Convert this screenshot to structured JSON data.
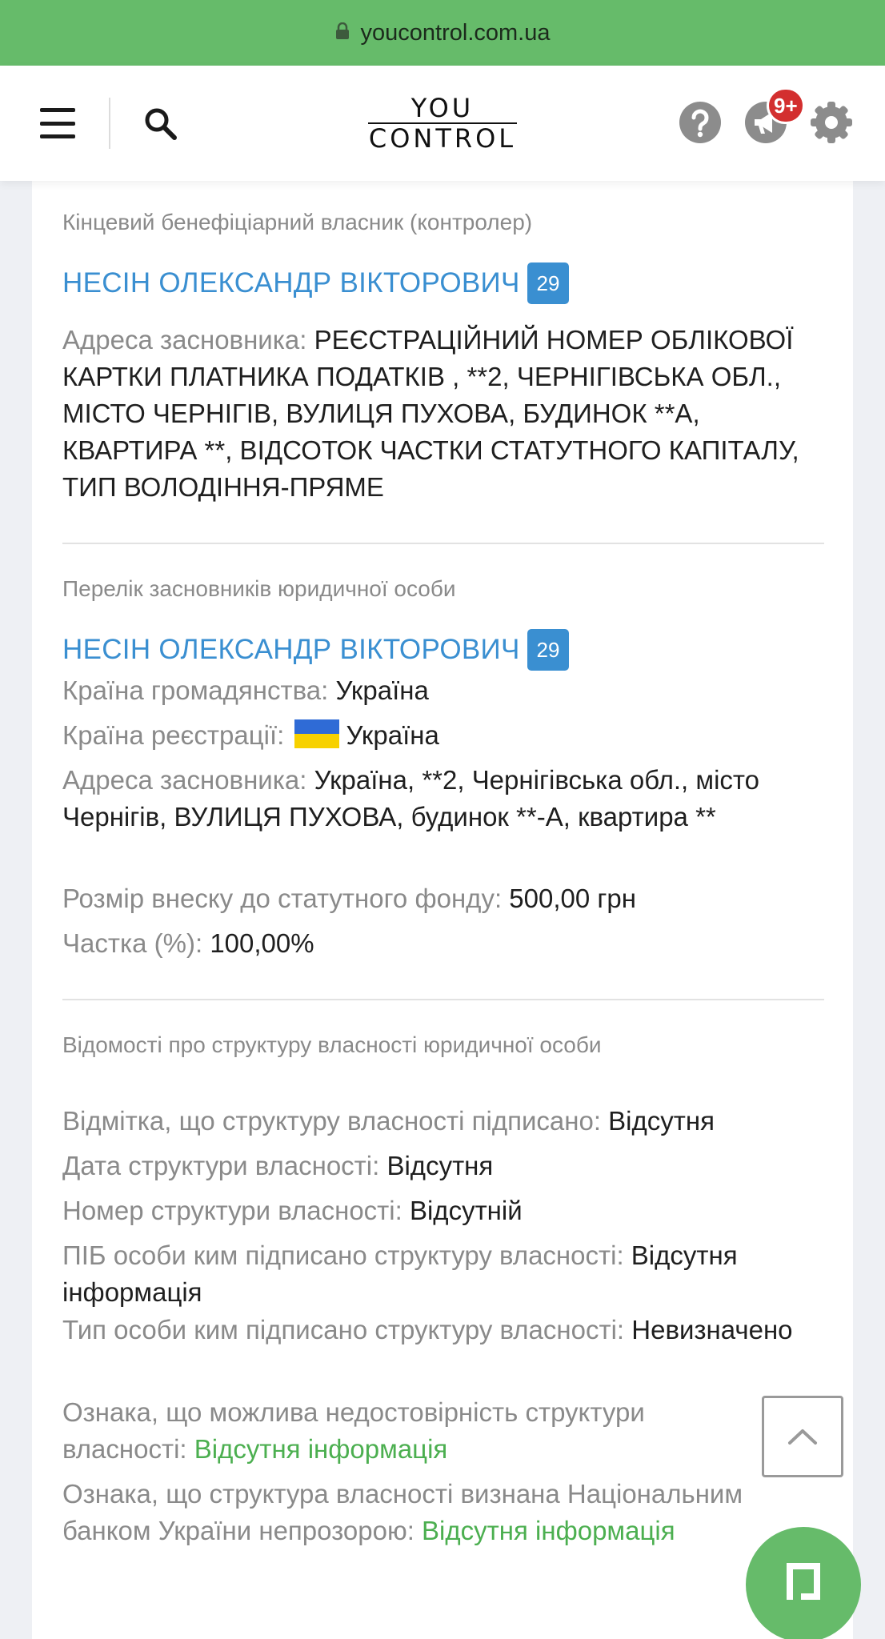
{
  "browser": {
    "url": "youcontrol.com.ua"
  },
  "header": {
    "logo_top": "YOU",
    "logo_bottom": "CONTROL",
    "notifications_badge": "9+",
    "icons": [
      "menu-icon",
      "search-icon",
      "help-icon",
      "megaphone-icon",
      "gear-icon"
    ]
  },
  "beneficiary": {
    "section_title": "Кінцевий бенефіціарний власник (контролер)",
    "name": "НЕСІН ОЛЕКСАНДР ВІКТОРОВИЧ",
    "badge": "29",
    "address_label": "Адреса засновника: ",
    "address_value": "РЕЄСТРАЦІЙНИЙ НОМЕР ОБЛІКОВОЇ КАРТКИ ПЛАТНИКА ПОДАТКІВ , **2, ЧЕРНІГІВСЬКА ОБЛ., МІСТО ЧЕРНІГІВ, ВУЛИЦЯ ПУХОВА, БУДИНОК **А, КВАРТИРА **, ВІДСОТОК ЧАСТКИ СТАТУТНОГО КАПІТАЛУ, ТИП ВОЛОДІННЯ-ПРЯМЕ"
  },
  "founders": {
    "section_title": "Перелік засновників юридичної особи",
    "name": "НЕСІН ОЛЕКСАНДР ВІКТОРОВИЧ",
    "badge": "29",
    "citizenship_label": "Країна громадянства: ",
    "citizenship_value": "Україна",
    "registration_label": "Країна реєстрації: ",
    "registration_value": "Україна",
    "address_label": "Адреса засновника: ",
    "address_value": "Україна, **2, Чернігівська обл., місто Чернігів, ВУЛИЦЯ ПУХОВА, будинок **-А, квартира **",
    "contribution_label": "Розмір внеску до статутного фонду: ",
    "contribution_value": "500,00 грн",
    "share_label": "Частка (%): ",
    "share_value": "100,00%"
  },
  "ownership": {
    "section_title": "Відомості про структуру власності юридичної особи",
    "signed_label": "Відмітка, що структуру власності підписано: ",
    "signed_value": "Відсутня",
    "date_label": "Дата структури власності: ",
    "date_value": "Відсутня",
    "number_label": "Номер структури власності: ",
    "number_value": "Відсутній",
    "signer_name_label": "ПІБ особи ким підписано структуру власності: ",
    "signer_name_value": "Відсутня інформація",
    "signer_type_label": "Тип особи ким підписано структуру власності: ",
    "signer_type_value": "Невизначено",
    "unreliable_label": "Ознака, що можлива недостовірність структури власності: ",
    "unreliable_value": "Відсутня інформація",
    "nontransparent_label": "Ознака, що структура власності визнана Національним банком України непрозорою: ",
    "nontransparent_value": "Відсутня інформація"
  },
  "colors": {
    "accent_green": "#66bb6a",
    "link_blue": "#3a8fd1",
    "badge_red": "#d32f2f",
    "label_gray": "#8a8a8a"
  }
}
